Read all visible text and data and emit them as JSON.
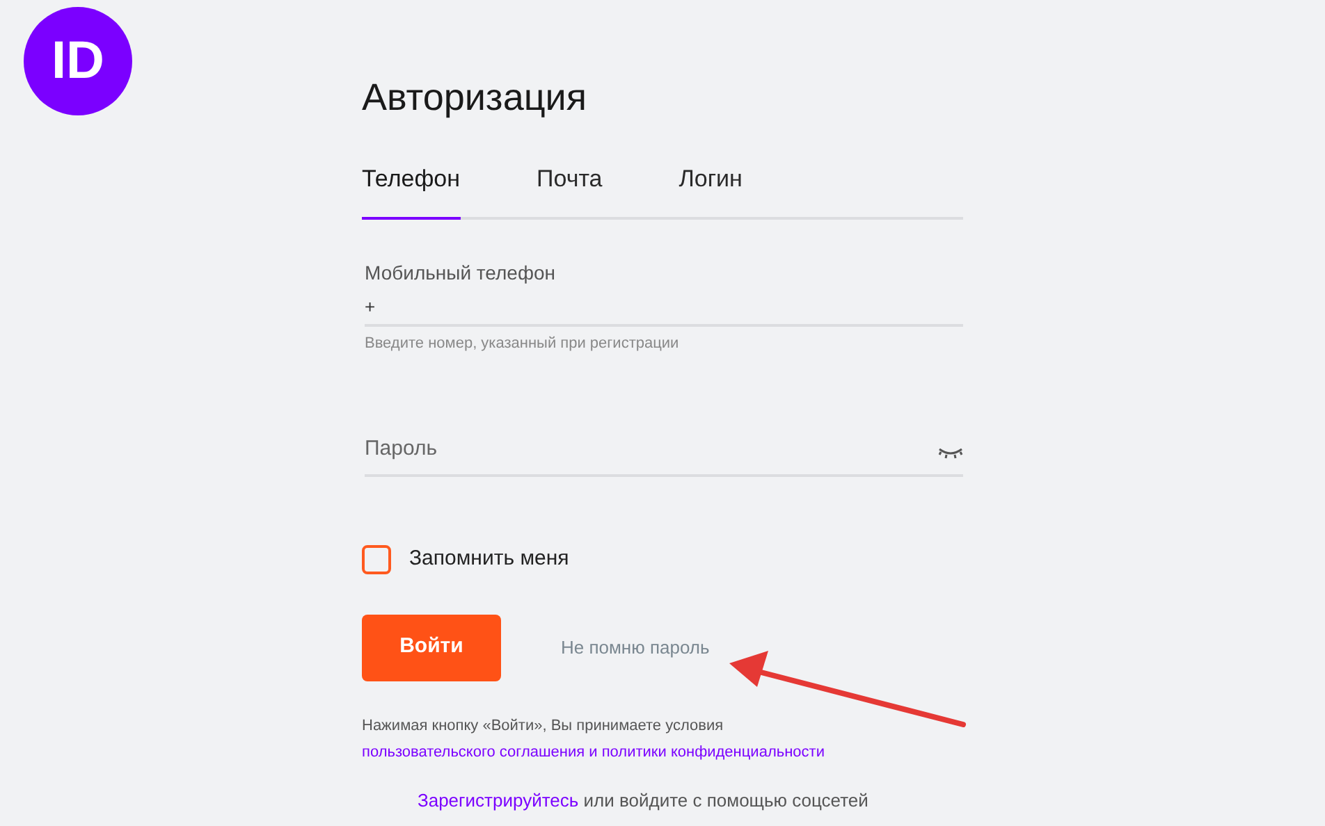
{
  "logo": {
    "text": "ID"
  },
  "title": "Авторизация",
  "tabs": [
    {
      "label": "Телефон",
      "selected": true
    },
    {
      "label": "Почта",
      "selected": false
    },
    {
      "label": "Логин",
      "selected": false
    }
  ],
  "phone_field": {
    "label": "Мобильный телефон",
    "value": "+",
    "hint": "Введите номер, указанный при регистрации"
  },
  "password_field": {
    "placeholder": "Пароль"
  },
  "remember": {
    "label": "Запомнить меня",
    "checked": false
  },
  "login_button": "Войти",
  "forgot_link": "Не помню пароль",
  "terms": {
    "text": "Нажимая кнопку «Войти», Вы принимаете условия",
    "link": "пользовательского соглашения и политики конфиденциальности"
  },
  "register": {
    "link": "Зарегистрируйтесь",
    "text": "или войдите с помощью соцсетей"
  }
}
